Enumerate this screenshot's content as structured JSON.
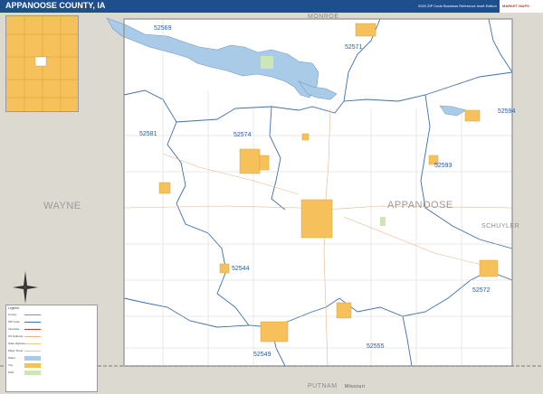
{
  "header": {
    "title": "APPANOOSE COUNTY, IA",
    "subtitle": "2020 ZIP Code Business Reference Inset Edition",
    "logo_text": "MARKET MAPS"
  },
  "counties": {
    "main": "APPANOOSE",
    "west": "WAYNE",
    "north": "MONROE",
    "south": "PUTNAM",
    "southeast": "SCHUYLER",
    "state_south": "Missouri"
  },
  "zip_labels": [
    "52569",
    "52571",
    "52581",
    "52574",
    "52594",
    "52593",
    "52544",
    "52572",
    "52549",
    "52555"
  ],
  "legend": {
    "title": "Legend",
    "rows": [
      "County",
      "ZIP Code",
      "Interstate",
      "US Highway",
      "State Highway",
      "Major Street",
      "Water",
      "City",
      "Park"
    ]
  },
  "colors": {
    "land": "#ffffff",
    "county_outside": "#dcd9d0",
    "water": "#a9cbe7",
    "city": "#f6c15a",
    "zip_border": "#3d6fae",
    "header": "#1e4f8c"
  }
}
